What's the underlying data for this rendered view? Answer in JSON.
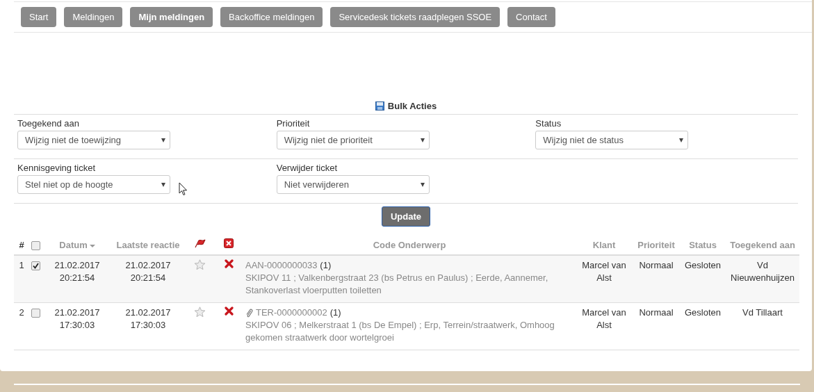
{
  "nav": [
    {
      "label": "Start",
      "selected": false
    },
    {
      "label": "Meldingen",
      "selected": false
    },
    {
      "label": "Mijn meldingen",
      "selected": true
    },
    {
      "label": "Backoffice meldingen",
      "selected": false
    },
    {
      "label": "Servicedesk tickets raadplegen SSOE",
      "selected": false
    },
    {
      "label": "Contact",
      "selected": false
    }
  ],
  "bulk": {
    "title": "Bulk Acties",
    "rows": [
      [
        {
          "label": "Toegekend aan",
          "value": "Wijzig niet de toewijzing"
        },
        {
          "label": "Prioriteit",
          "value": "Wijzig niet de prioriteit"
        },
        {
          "label": "Status",
          "value": "Wijzig niet de status"
        }
      ],
      [
        {
          "label": "Kennisgeving ticket",
          "value": "Stel niet op de hoogte"
        },
        {
          "label": "Verwijder ticket",
          "value": "Niet verwijderen"
        }
      ]
    ],
    "button": "Update"
  },
  "table": {
    "columns": {
      "number": "#",
      "all_checked": false,
      "date": "Datum",
      "last": "Laatste reactie",
      "code": "Code Onderwerp",
      "client": "Klant",
      "priority": "Prioriteit",
      "status": "Status",
      "assigned": "Toegekend aan"
    },
    "rows": [
      {
        "number": "1",
        "checked": true,
        "date": [
          "21.02.2017",
          "20:21:54"
        ],
        "last": [
          "21.02.2017",
          "20:21:54"
        ],
        "starred": false,
        "attachment": false,
        "code": "AAN-0000000033",
        "count": "(1)",
        "subject": "SKIPOV 11 ; Valkenbergstraat 23 (bs Petrus en Paulus) ; Eerde, Aannemer, Stankoverlast vloerputten toiletten",
        "client": "Marcel van Alst",
        "priority": "Normaal",
        "status": "Gesloten",
        "assigned": "Vd Nieuwenhuijzen"
      },
      {
        "number": "2",
        "checked": false,
        "date": [
          "21.02.2017",
          "17:30:03"
        ],
        "last": [
          "21.02.2017",
          "17:30:03"
        ],
        "starred": false,
        "attachment": true,
        "code": "TER-0000000002",
        "count": "(1)",
        "subject": "SKIPOV 06 ; Melkerstraat 1 (bs De Empel) ; Erp, Terrein/straatwerk, Omhoog gekomen straatwerk door wortelgroei",
        "client": "Marcel van Alst",
        "priority": "Normaal",
        "status": "Gesloten",
        "assigned": "Vd Tillaart"
      }
    ]
  }
}
